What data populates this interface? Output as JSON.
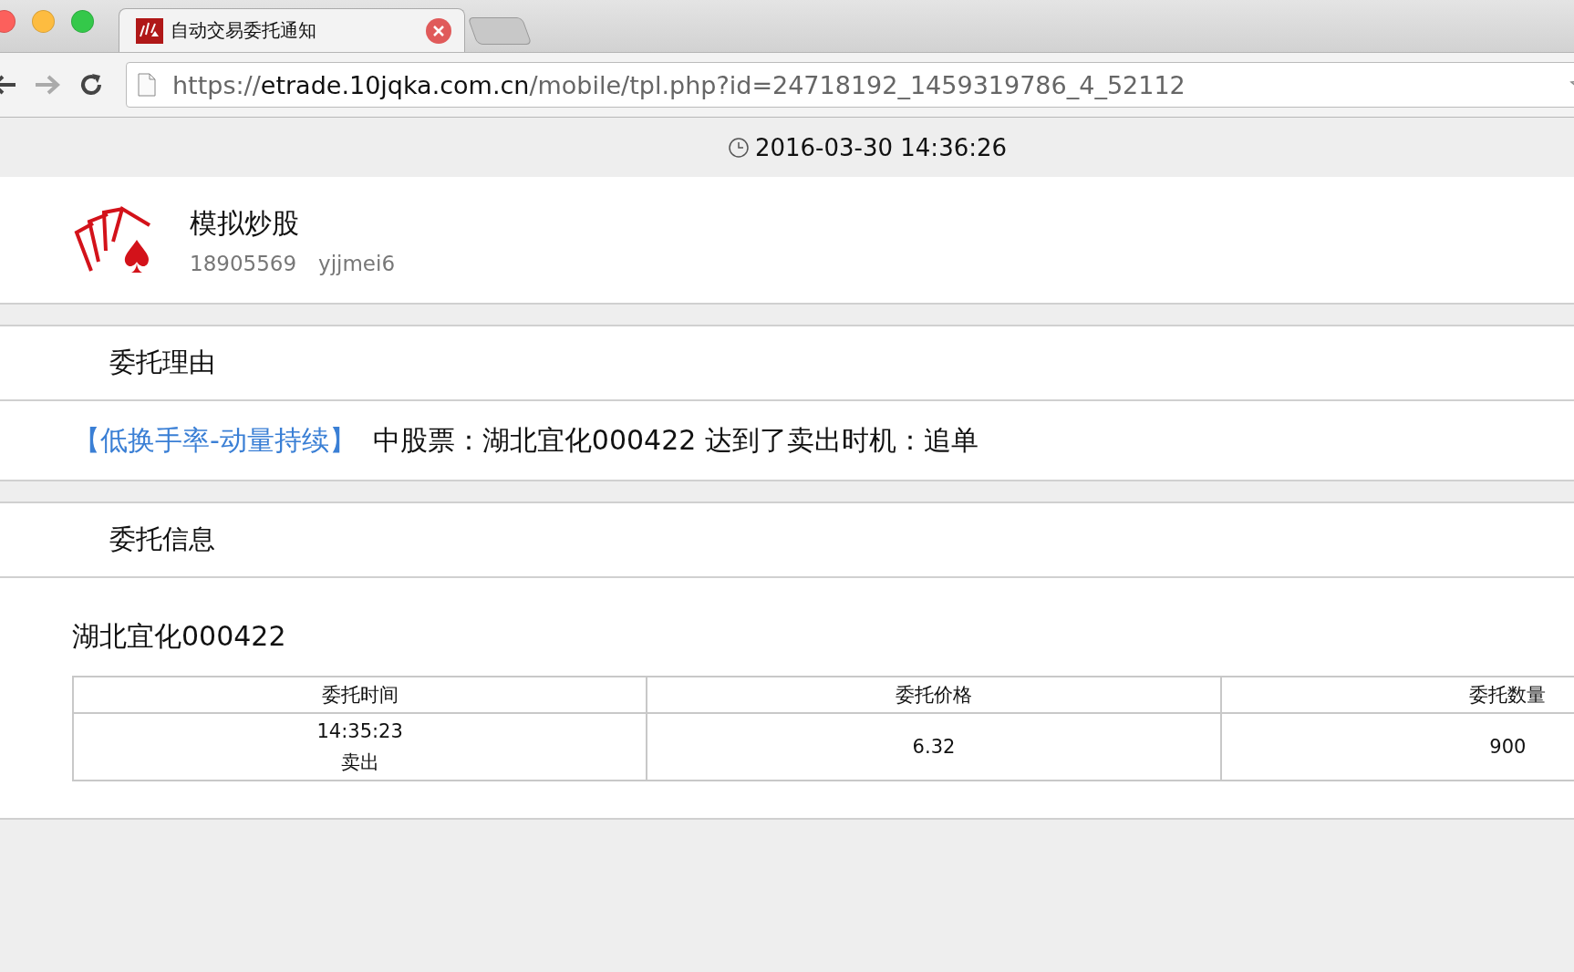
{
  "browser": {
    "tab": {
      "title": "自动交易委托通知",
      "selected": true
    },
    "url": {
      "scheme": "https://",
      "host": "etrade.10jqka.com.cn",
      "path": "/mobile/tpl.php?id=24718192_1459319786_4_52112"
    }
  },
  "timestamp": "2016-03-30 14:36:26",
  "account": {
    "name": "模拟炒股",
    "id": "18905569",
    "user": "yjjmei6"
  },
  "reason": {
    "heading": "委托理由",
    "strategy": "【低换手率-动量持续】",
    "message": "中股票：湖北宜化000422 达到了卖出时机：追单"
  },
  "order": {
    "heading": "委托信息",
    "stock": "湖北宜化000422",
    "table": {
      "columns": [
        "委托时间",
        "委托价格",
        "委托数量"
      ],
      "rows": [
        {
          "time": "14:35:23",
          "side": "卖出",
          "price": "6.32",
          "quantity": "900"
        }
      ]
    }
  }
}
